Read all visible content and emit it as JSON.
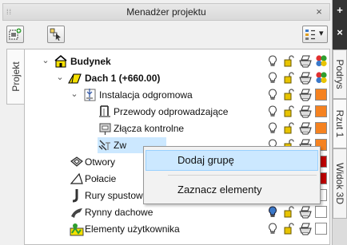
{
  "panel": {
    "title": "Menadżer projektu",
    "grip": "⁞⁞",
    "close": "×"
  },
  "toolbar": {
    "add_group_icon": "add-group-icon",
    "select_icon": "select-icon",
    "filter_icon": "filter-dropdown-icon",
    "dropdown_arrow": "▾"
  },
  "left_tab": {
    "label": "Projekt"
  },
  "right_tabs": {
    "plus": "+",
    "close": "×",
    "tabs": [
      "Podrys",
      "Rzut 1",
      "Widok 3D"
    ]
  },
  "tree": {
    "rows": [
      {
        "label": "Budynek",
        "bold": true,
        "expander": "⌄",
        "icon": "building-icon",
        "color": "multi"
      },
      {
        "label": "Dach 1 (+660.00)",
        "bold": true,
        "expander": "⌄",
        "icon": "roof-icon",
        "color": "multi"
      },
      {
        "label": "Instalacja odgromowa",
        "bold": false,
        "expander": "⌄",
        "icon": "lightning-protection-icon",
        "color": "#f58220"
      },
      {
        "label": "Przewody odprowadzające",
        "bold": false,
        "expander": "",
        "icon": "down-conductor-icon",
        "color": "#f58220"
      },
      {
        "label": "Złącza kontrolne",
        "bold": false,
        "expander": "",
        "icon": "test-joint-icon",
        "color": "#f58220"
      },
      {
        "label": "Zw",
        "bold": false,
        "expander": "",
        "icon": "earthing-icon",
        "color": "#f58220"
      },
      {
        "label": "Otwory",
        "bold": false,
        "expander": "",
        "icon": "opening-icon",
        "color": "#c00000"
      },
      {
        "label": "Połacie",
        "bold": false,
        "expander": "",
        "icon": "roof-plane-icon",
        "color": "#c00000"
      },
      {
        "label": "Rury spustowe",
        "bold": false,
        "expander": "",
        "icon": "downpipe-icon",
        "color": "#ffffff"
      },
      {
        "label": "Rynny dachowe",
        "bold": false,
        "expander": "",
        "icon": "gutter-icon",
        "color": "#ffffff"
      },
      {
        "label": "Elementy użytkownika",
        "bold": false,
        "expander": "",
        "icon": "user-elements-icon",
        "color": "#ffffff"
      }
    ]
  },
  "context_menu": {
    "items": [
      "Dodaj grupę",
      "Zaznacz elementy"
    ]
  },
  "colors": {
    "orange": "#f58220",
    "red": "#c00000",
    "highlight": "#cce8ff",
    "bulb": "#e8c400"
  }
}
